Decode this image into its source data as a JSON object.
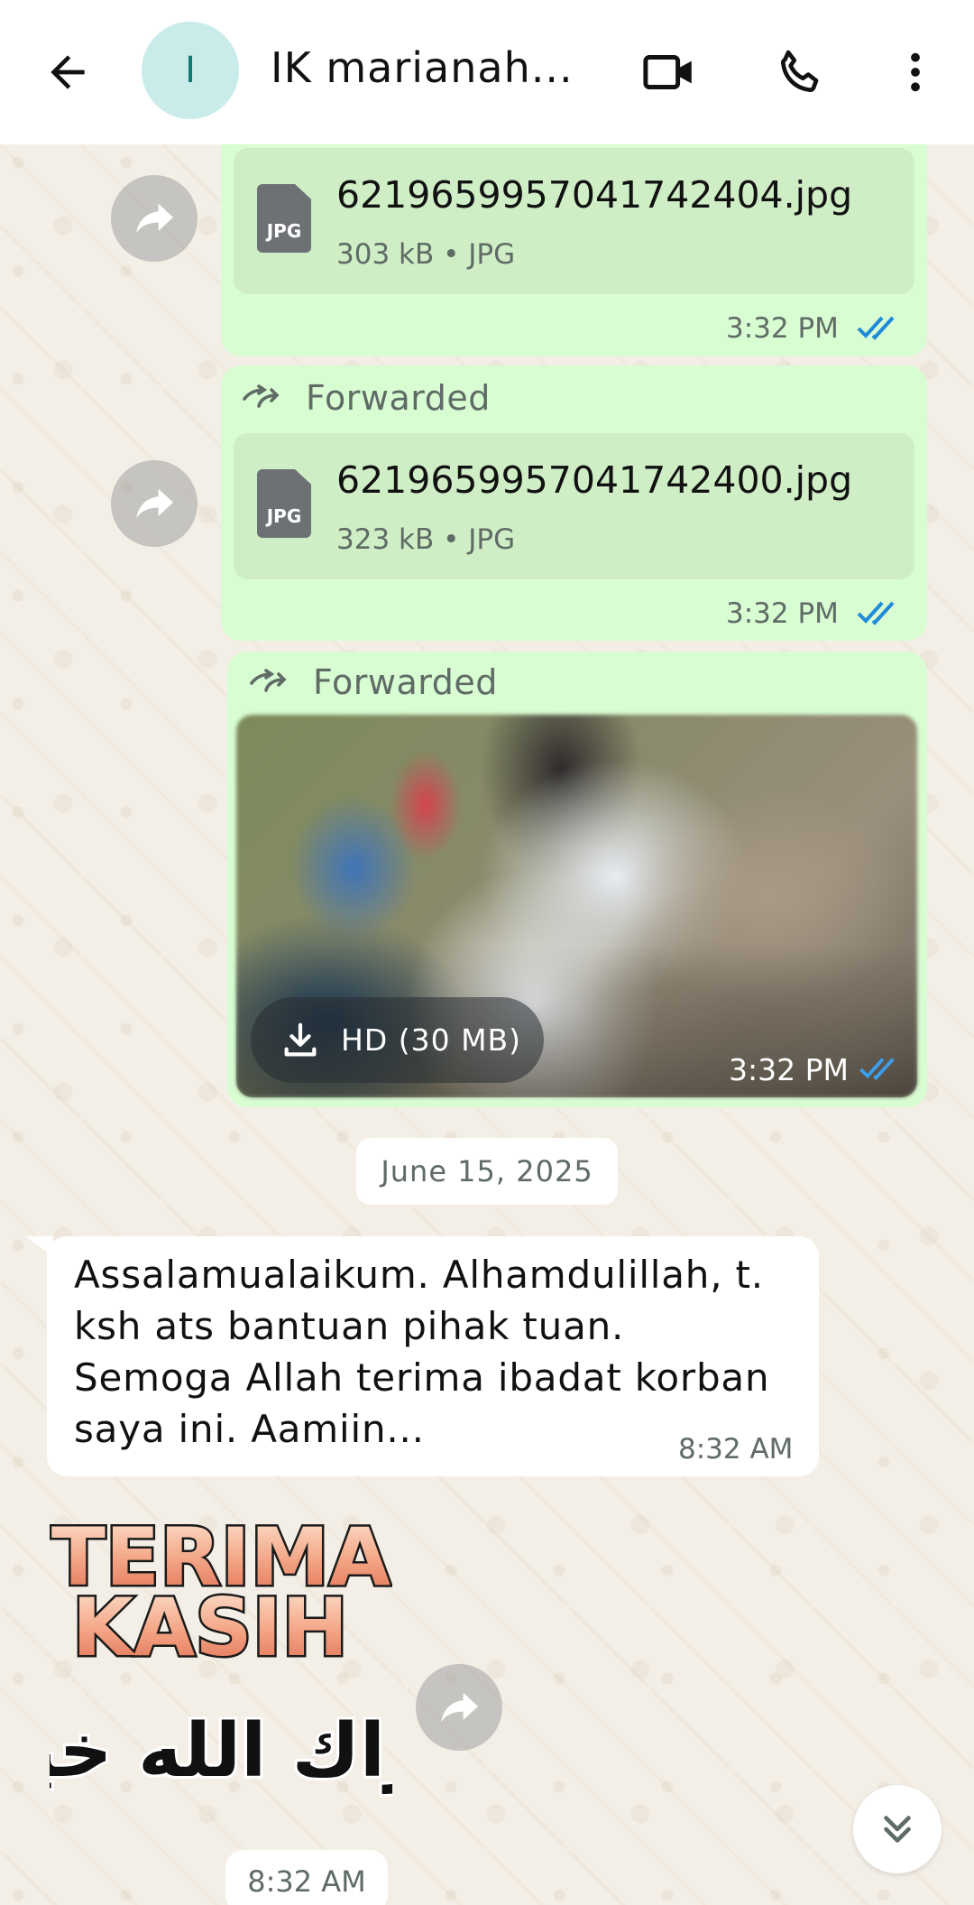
{
  "header": {
    "avatar_letter": "I",
    "title": "IK marianah..."
  },
  "messages": [
    {
      "type": "document",
      "direction": "out",
      "file_name": "6219659957041742404.jpg",
      "file_meta": "303 kB • JPG",
      "file_icon_label": "JPG",
      "time": "3:32 PM"
    },
    {
      "type": "document",
      "direction": "out",
      "forwarded_label": "Forwarded",
      "file_name": "6219659957041742400.jpg",
      "file_meta": "323 kB • JPG",
      "file_icon_label": "JPG",
      "time": "3:32 PM"
    },
    {
      "type": "image",
      "direction": "out",
      "forwarded_label": "Forwarded",
      "download_label": "HD (30 MB)",
      "time": "3:32 PM"
    }
  ],
  "date_divider": "June 15, 2025",
  "incoming": {
    "text": "Assalamualaikum. Alhamdulillah, t. ksh ats bantuan pihak tuan. Semoga Allah terima ibadat korban saya ini. Aamiin...",
    "time": "8:32 AM"
  },
  "sticker": {
    "line1": "TERIMA",
    "line2": "KASIH",
    "arabic": "جزاك الله خيرا",
    "time": "8:32 AM"
  },
  "colors": {
    "outgoing_bubble": "#d9fdd3",
    "read_ticks": "#1f8ad8",
    "wallpaper": "#f4efe6"
  },
  "icons": [
    "back-arrow-icon",
    "video-call-icon",
    "phone-icon",
    "more-vert-icon",
    "forward-icon",
    "download-icon",
    "double-chevron-down-icon",
    "read-ticks-icon"
  ]
}
